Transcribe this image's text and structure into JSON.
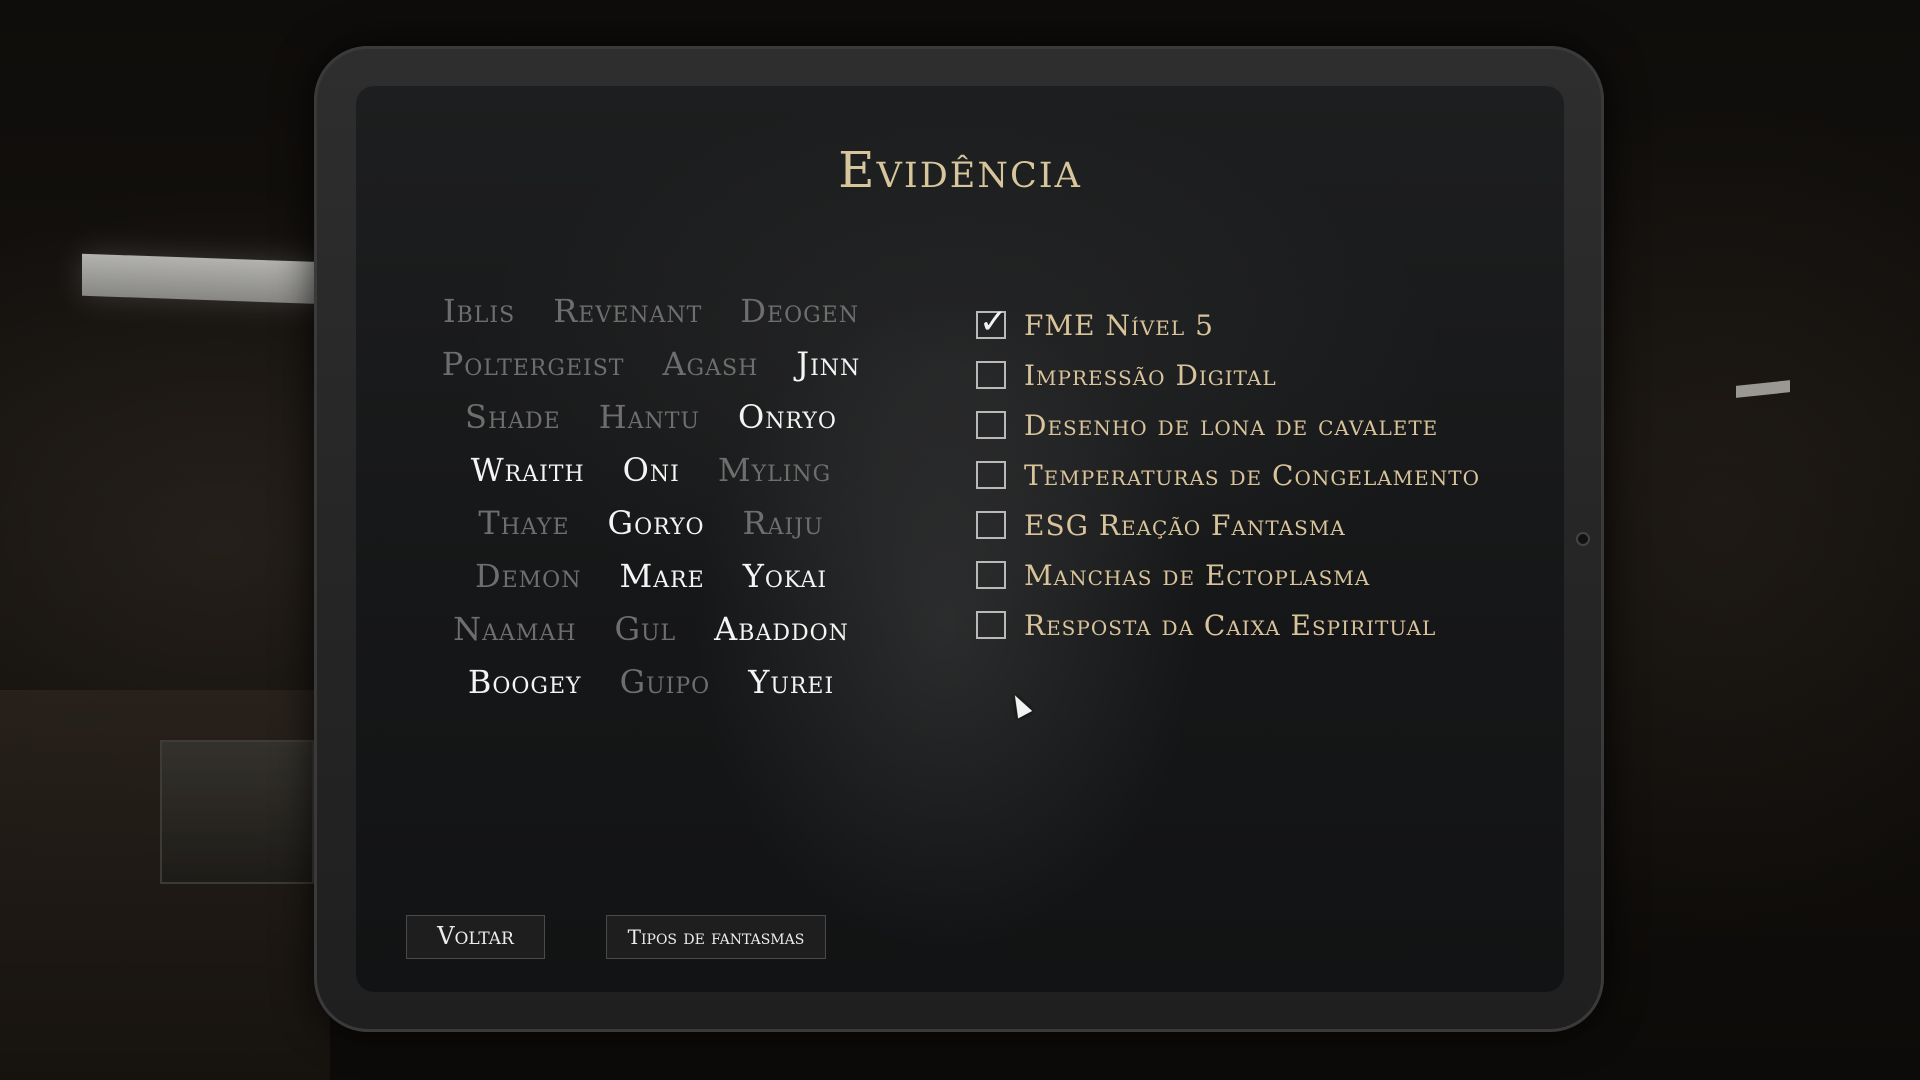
{
  "title": "Evidência",
  "ghost_rows": [
    [
      {
        "name": "Iblis",
        "status": "excluded"
      },
      {
        "name": "Revenant",
        "status": "excluded"
      },
      {
        "name": "Deogen",
        "status": "excluded"
      }
    ],
    [
      {
        "name": "Poltergeist",
        "status": "excluded"
      },
      {
        "name": "Agash",
        "status": "excluded"
      },
      {
        "name": "Jinn",
        "status": "possible"
      }
    ],
    [
      {
        "name": "Shade",
        "status": "excluded"
      },
      {
        "name": "Hantu",
        "status": "excluded"
      },
      {
        "name": "Onryo",
        "status": "possible"
      }
    ],
    [
      {
        "name": "Wraith",
        "status": "possible"
      },
      {
        "name": "Oni",
        "status": "possible"
      },
      {
        "name": "Myling",
        "status": "excluded"
      }
    ],
    [
      {
        "name": "Thaye",
        "status": "excluded"
      },
      {
        "name": "Goryo",
        "status": "possible"
      },
      {
        "name": "Raiju",
        "status": "excluded"
      }
    ],
    [
      {
        "name": "Demon",
        "status": "excluded"
      },
      {
        "name": "Mare",
        "status": "possible"
      },
      {
        "name": "Yokai",
        "status": "possible"
      }
    ],
    [
      {
        "name": "Naamah",
        "status": "excluded"
      },
      {
        "name": "Gul",
        "status": "excluded"
      },
      {
        "name": "Abaddon",
        "status": "possible"
      }
    ],
    [
      {
        "name": "Boogey",
        "status": "possible"
      },
      {
        "name": "Guipo",
        "status": "excluded"
      },
      {
        "name": "Yurei",
        "status": "possible"
      }
    ]
  ],
  "evidence": [
    {
      "label": "FME Nível 5",
      "checked": true
    },
    {
      "label": "Impressão Digital",
      "checked": false
    },
    {
      "label": "Desenho de lona de cavalete",
      "checked": false
    },
    {
      "label": "Temperaturas de Congelamento",
      "checked": false
    },
    {
      "label": "ESG Reação Fantasma",
      "checked": false
    },
    {
      "label": "Manchas de Ectoplasma",
      "checked": false
    },
    {
      "label": "Resposta da Caixa Espiritual",
      "checked": false
    }
  ],
  "buttons": {
    "back_label": "Voltar",
    "ghost_types_label": "Tipos de fantasmas"
  },
  "icons": {
    "checkmark": "check-icon",
    "cursor": "cursor-icon"
  },
  "colors": {
    "title_gold": "#d7c59c",
    "evidence_gold": "#d8c39a",
    "possible_ghost": "#f4f4f4",
    "excluded_ghost": "#6e6e6e"
  }
}
